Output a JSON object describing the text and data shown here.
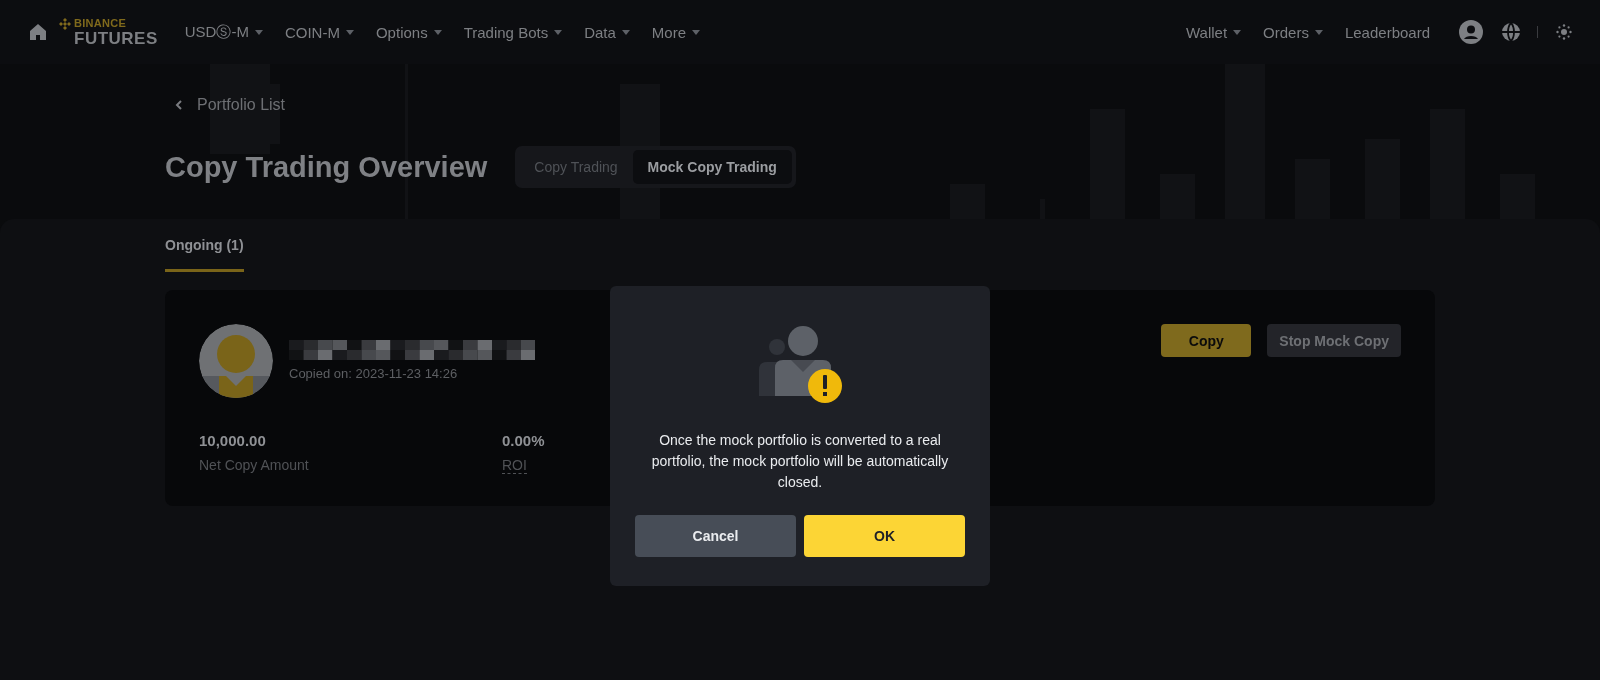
{
  "nav": {
    "logo_top": "BINANCE",
    "logo_bottom": "FUTURES",
    "items": [
      {
        "label": "USDⓈ-M",
        "dropdown": true
      },
      {
        "label": "COIN-M",
        "dropdown": true
      },
      {
        "label": "Options",
        "dropdown": true
      },
      {
        "label": "Trading Bots",
        "dropdown": true
      },
      {
        "label": "Data",
        "dropdown": true
      },
      {
        "label": "More",
        "dropdown": true
      }
    ],
    "right_items": [
      {
        "label": "Wallet",
        "dropdown": true
      },
      {
        "label": "Orders",
        "dropdown": true
      },
      {
        "label": "Leaderboard",
        "dropdown": false
      }
    ]
  },
  "back_link": "Portfolio List",
  "title": "Copy Trading Overview",
  "mode_tabs": [
    {
      "label": "Copy Trading",
      "selected": false
    },
    {
      "label": "Mock Copy Trading",
      "selected": true
    }
  ],
  "section_tabs": [
    {
      "label": "Ongoing (1)",
      "selected": true
    }
  ],
  "portfolio": {
    "copied_on": "Copied on: 2023-11-23 14:26",
    "stats": [
      {
        "value": "10,000.00",
        "label": "Net Copy Amount",
        "hint": false
      },
      {
        "value": "0.00%",
        "label": "ROI",
        "hint": true
      }
    ],
    "buttons": [
      {
        "label": "Copy",
        "kind": "primary"
      },
      {
        "label": "Stop Mock Copy",
        "kind": "secondary"
      }
    ]
  },
  "modal": {
    "message": "Once the mock portfolio is converted to a real portfolio, the mock portfolio will be automatically closed.",
    "buttons": [
      {
        "label": "Cancel",
        "kind": "secondary"
      },
      {
        "label": "OK",
        "kind": "primary"
      }
    ]
  }
}
